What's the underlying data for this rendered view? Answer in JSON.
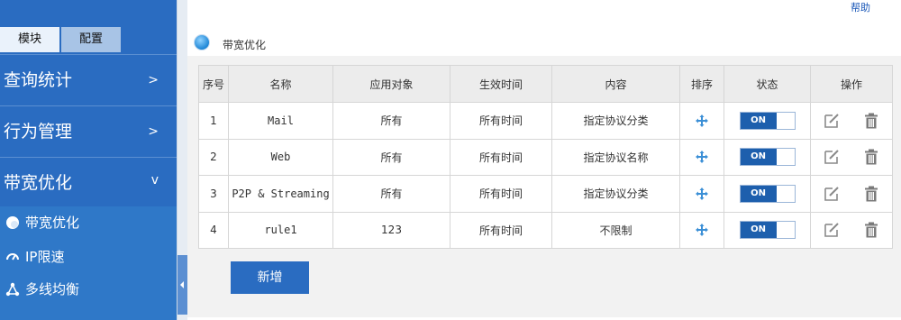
{
  "sidebar": {
    "tabs": [
      {
        "label": "模块",
        "active": true
      },
      {
        "label": "配置",
        "active": false
      }
    ],
    "groups": [
      {
        "label": "查询统计",
        "chevron": ">"
      },
      {
        "label": "行为管理",
        "chevron": ">"
      },
      {
        "label": "带宽优化",
        "chevron": "v"
      }
    ],
    "subitems": [
      {
        "label": "带宽优化",
        "icon": "circle-icon"
      },
      {
        "label": "IP限速",
        "icon": "gauge-icon"
      },
      {
        "label": "多线均衡",
        "icon": "share-nodes-icon"
      }
    ]
  },
  "header": {
    "help": "帮助",
    "title": "带宽优化"
  },
  "table": {
    "headers": [
      "序号",
      "名称",
      "应用对象",
      "生效时间",
      "内容",
      "排序",
      "状态",
      "操作"
    ],
    "rows": [
      {
        "index": "1",
        "name": "Mail",
        "target": "所有",
        "time": "所有时间",
        "content": "指定协议分类",
        "status": "ON"
      },
      {
        "index": "2",
        "name": "Web",
        "target": "所有",
        "time": "所有时间",
        "content": "指定协议名称",
        "status": "ON"
      },
      {
        "index": "3",
        "name": "P2P & Streaming",
        "target": "所有",
        "time": "所有时间",
        "content": "指定协议分类",
        "status": "ON"
      },
      {
        "index": "4",
        "name": "rule1",
        "target": "123",
        "time": "所有时间",
        "content": "不限制",
        "status": "ON"
      }
    ]
  },
  "add_button": "新增",
  "colors": {
    "sidebar": "#2a6cc1",
    "toggle_on": "#1d5fad",
    "accent": "#1e86d6"
  }
}
